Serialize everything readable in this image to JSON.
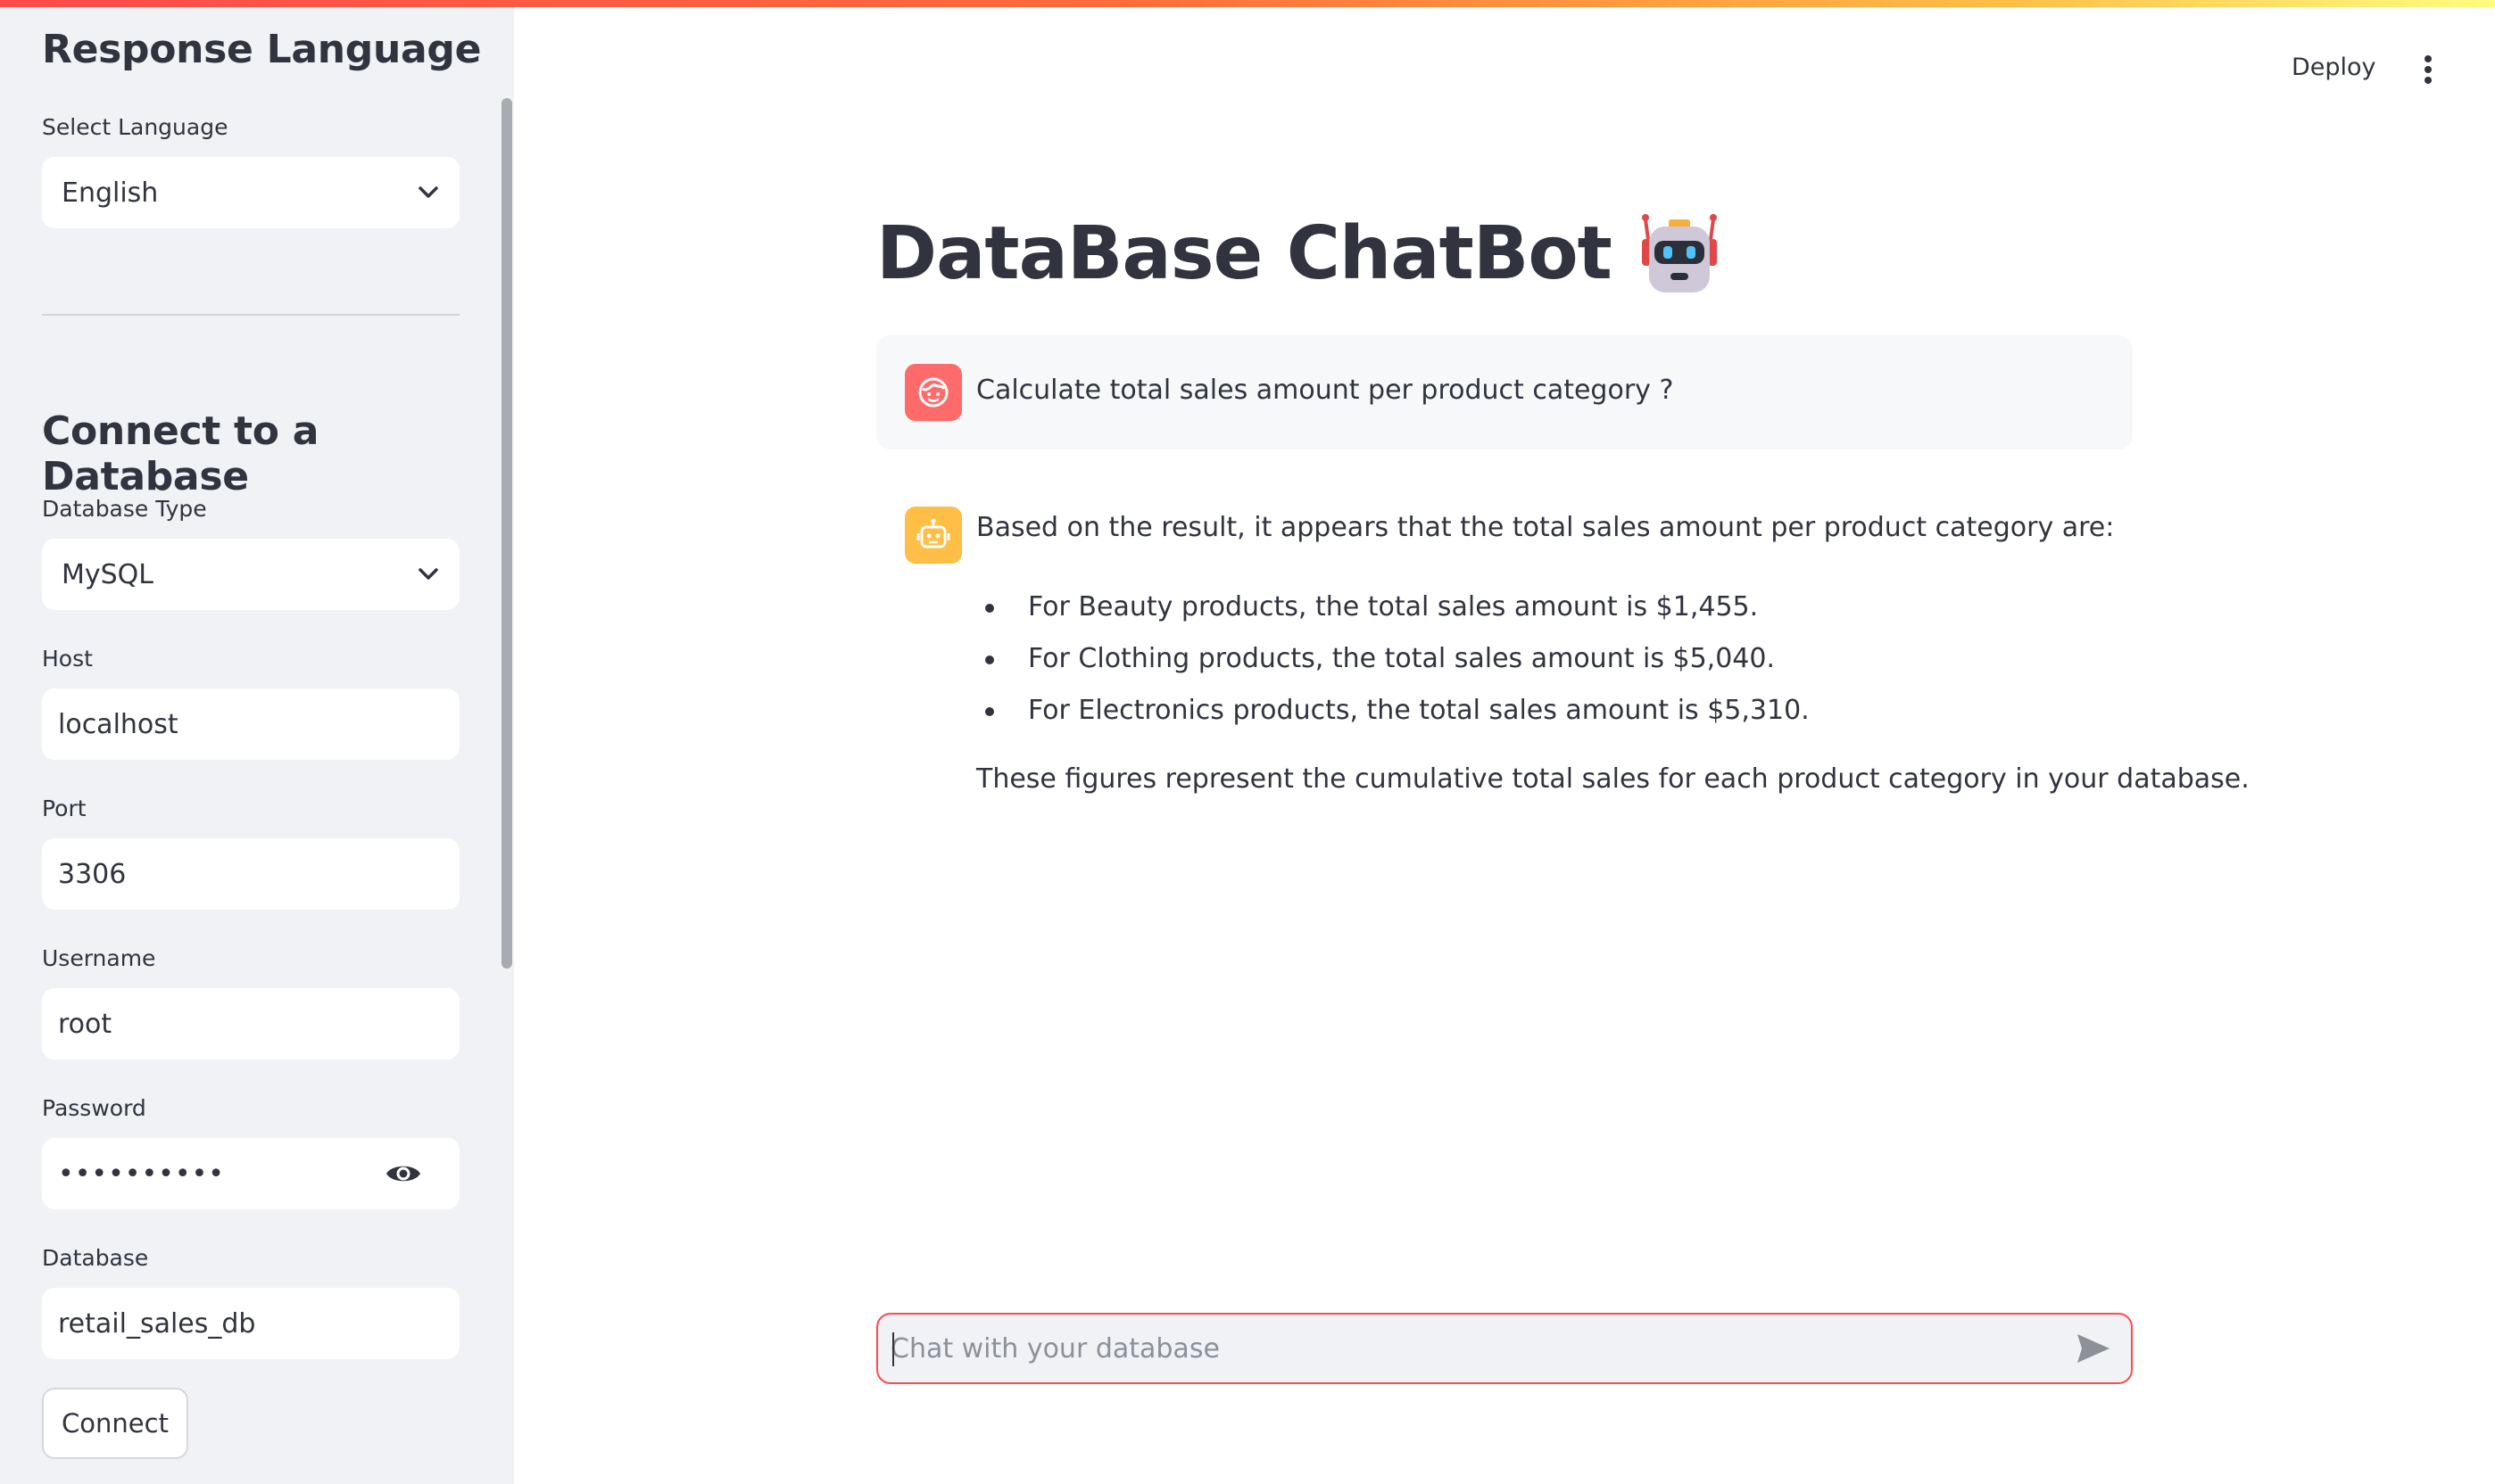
{
  "sidebar": {
    "language_heading": "Response Language",
    "language_label": "Select Language",
    "language_value": "English",
    "connect_heading": "Connect to a Database",
    "db_type_label": "Database Type",
    "db_type_value": "MySQL",
    "host_label": "Host",
    "host_value": "localhost",
    "port_label": "Port",
    "port_value": "3306",
    "username_label": "Username",
    "username_value": "root",
    "password_label": "Password",
    "password_masked": "••••••••••",
    "database_label": "Database",
    "database_value": "retail_sales_db",
    "connect_button": "Connect"
  },
  "header": {
    "deploy_label": "Deploy",
    "menu_icon": "vertical-ellipsis-icon"
  },
  "main": {
    "title": "DataBase ChatBot",
    "title_icon": "robot-emoji-icon",
    "messages": [
      {
        "role": "user",
        "icon": "user-face-icon",
        "text": "Calculate total sales amount per product category ?"
      },
      {
        "role": "assistant",
        "icon": "bot-icon",
        "intro": "Based on the result, it appears that the total sales amount per product category are:",
        "bullets": [
          "For Beauty products, the total sales amount is $1,455.",
          "For Clothing products, the total sales amount is $5,040.",
          "For Electronics products, the total sales amount is $5,310."
        ],
        "outro": "These figures represent the cumulative total sales for each product category in your database."
      }
    ],
    "chat_input": {
      "placeholder": "Chat with your database",
      "value": ""
    }
  },
  "colors": {
    "accent": "#ff4b4b",
    "user_avatar": "#ff6b6b",
    "bot_avatar": "#ffbe45",
    "sidebar_bg": "#f0f2f6",
    "text": "#31333f"
  }
}
